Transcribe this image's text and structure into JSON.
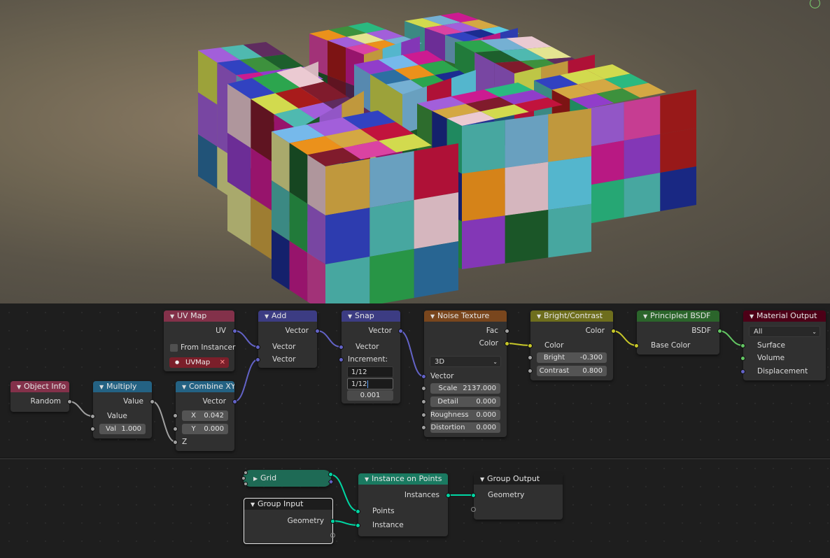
{
  "shader_nodes": {
    "object_info": {
      "title": "Object Info",
      "out_random": "Random"
    },
    "multiply": {
      "title": "Multiply",
      "out_value": "Value",
      "in_value": "Value",
      "val_label": "Val",
      "val_value": "1.000"
    },
    "combine_xyz": {
      "title": "Combine XYZ",
      "out_vector": "Vector",
      "x_label": "X",
      "x_value": "0.042",
      "y_label": "Y",
      "y_value": "0.000",
      "z_label": "Z"
    },
    "uv_map": {
      "title": "UV Map",
      "out_uv": "UV",
      "from_instancer": "From Instancer",
      "uvmap_tag": "UVMap"
    },
    "add": {
      "title": "Add",
      "out_vector": "Vector",
      "in_vector_1": "Vector",
      "in_vector_2": "Vector"
    },
    "snap": {
      "title": "Snap",
      "out_vector": "Vector",
      "in_vector": "Vector",
      "increment_label": "Increment:",
      "inc_x": "1/12",
      "inc_y": "1/12",
      "inc_z": "0.001"
    },
    "noise_texture": {
      "title": "Noise Texture",
      "out_fac": "Fac",
      "out_color": "Color",
      "dimension": "3D",
      "in_vector": "Vector",
      "scale_label": "Scale",
      "scale_value": "2137.000",
      "detail_label": "Detail",
      "detail_value": "0.000",
      "roughness_label": "Roughness",
      "roughness_value": "0.000",
      "distortion_label": "Distortion",
      "distortion_value": "0.000"
    },
    "bright_contrast": {
      "title": "Bright/Contrast",
      "out_color": "Color",
      "in_color": "Color",
      "bright_label": "Bright",
      "bright_value": "-0.300",
      "contrast_label": "Contrast",
      "contrast_value": "0.800"
    },
    "principled_bsdf": {
      "title": "Principled BSDF",
      "out_bsdf": "BSDF",
      "in_base_color": "Base Color"
    },
    "material_output": {
      "title": "Material Output",
      "target": "All",
      "in_surface": "Surface",
      "in_volume": "Volume",
      "in_displacement": "Displacement"
    }
  },
  "geometry_nodes": {
    "grid": {
      "title": "Grid"
    },
    "group_input": {
      "title": "Group Input",
      "out_geometry": "Geometry"
    },
    "instance_on_points": {
      "title": "Instance on Points",
      "out_instances": "Instances",
      "in_points": "Points",
      "in_instance": "Instance"
    },
    "group_output": {
      "title": "Group Output",
      "in_geometry": "Geometry"
    }
  },
  "colors": {
    "input_header": "#83314a",
    "converter_header": "#246283",
    "vector_header": "#3c3c83",
    "texture_header": "#79461d",
    "color_header": "#6e6e1d",
    "shader_header": "#2b652b",
    "output_header": "#4d0017",
    "geometry_header": "#00d6a3",
    "group_header": "#1d1d1d",
    "socket_float": "#a1a1a1",
    "socket_vector": "#6363c7",
    "socket_color": "#c7c729",
    "socket_shader": "#63c763",
    "socket_geometry": "#00d6a3"
  }
}
